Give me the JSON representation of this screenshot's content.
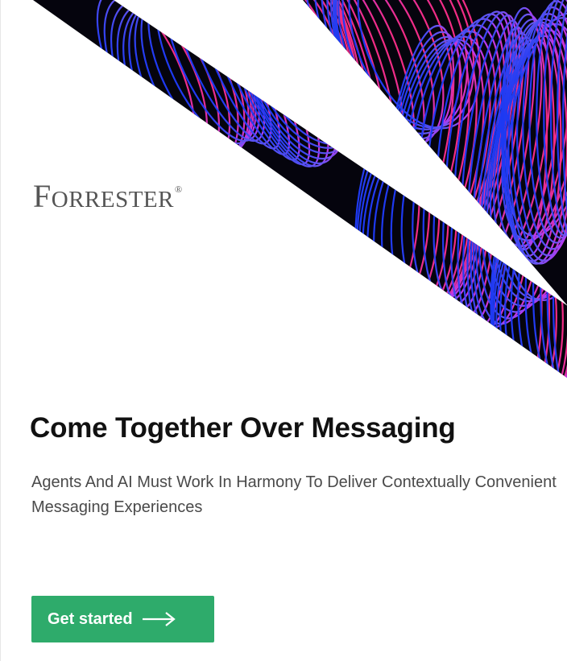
{
  "brand": {
    "logo_text": "Forrester",
    "logo_first": "F",
    "logo_rest": "ORRESTER",
    "logo_mark": "®"
  },
  "hero": {
    "title": "Come Together Over Messaging",
    "subtitle": "Agents And AI Must Work In Harmony To Deliver Contextually Convenient Messaging Experiences"
  },
  "cta": {
    "label": "Get started",
    "icon": "arrow-right-icon",
    "color": "#2eab6b"
  },
  "colors": {
    "title": "#111111",
    "subtitle": "#4a4a4a",
    "art_background": "#05040d",
    "art_blue": "#3b6cff",
    "art_violet": "#9b4dff",
    "art_pink": "#ff2f8a"
  }
}
